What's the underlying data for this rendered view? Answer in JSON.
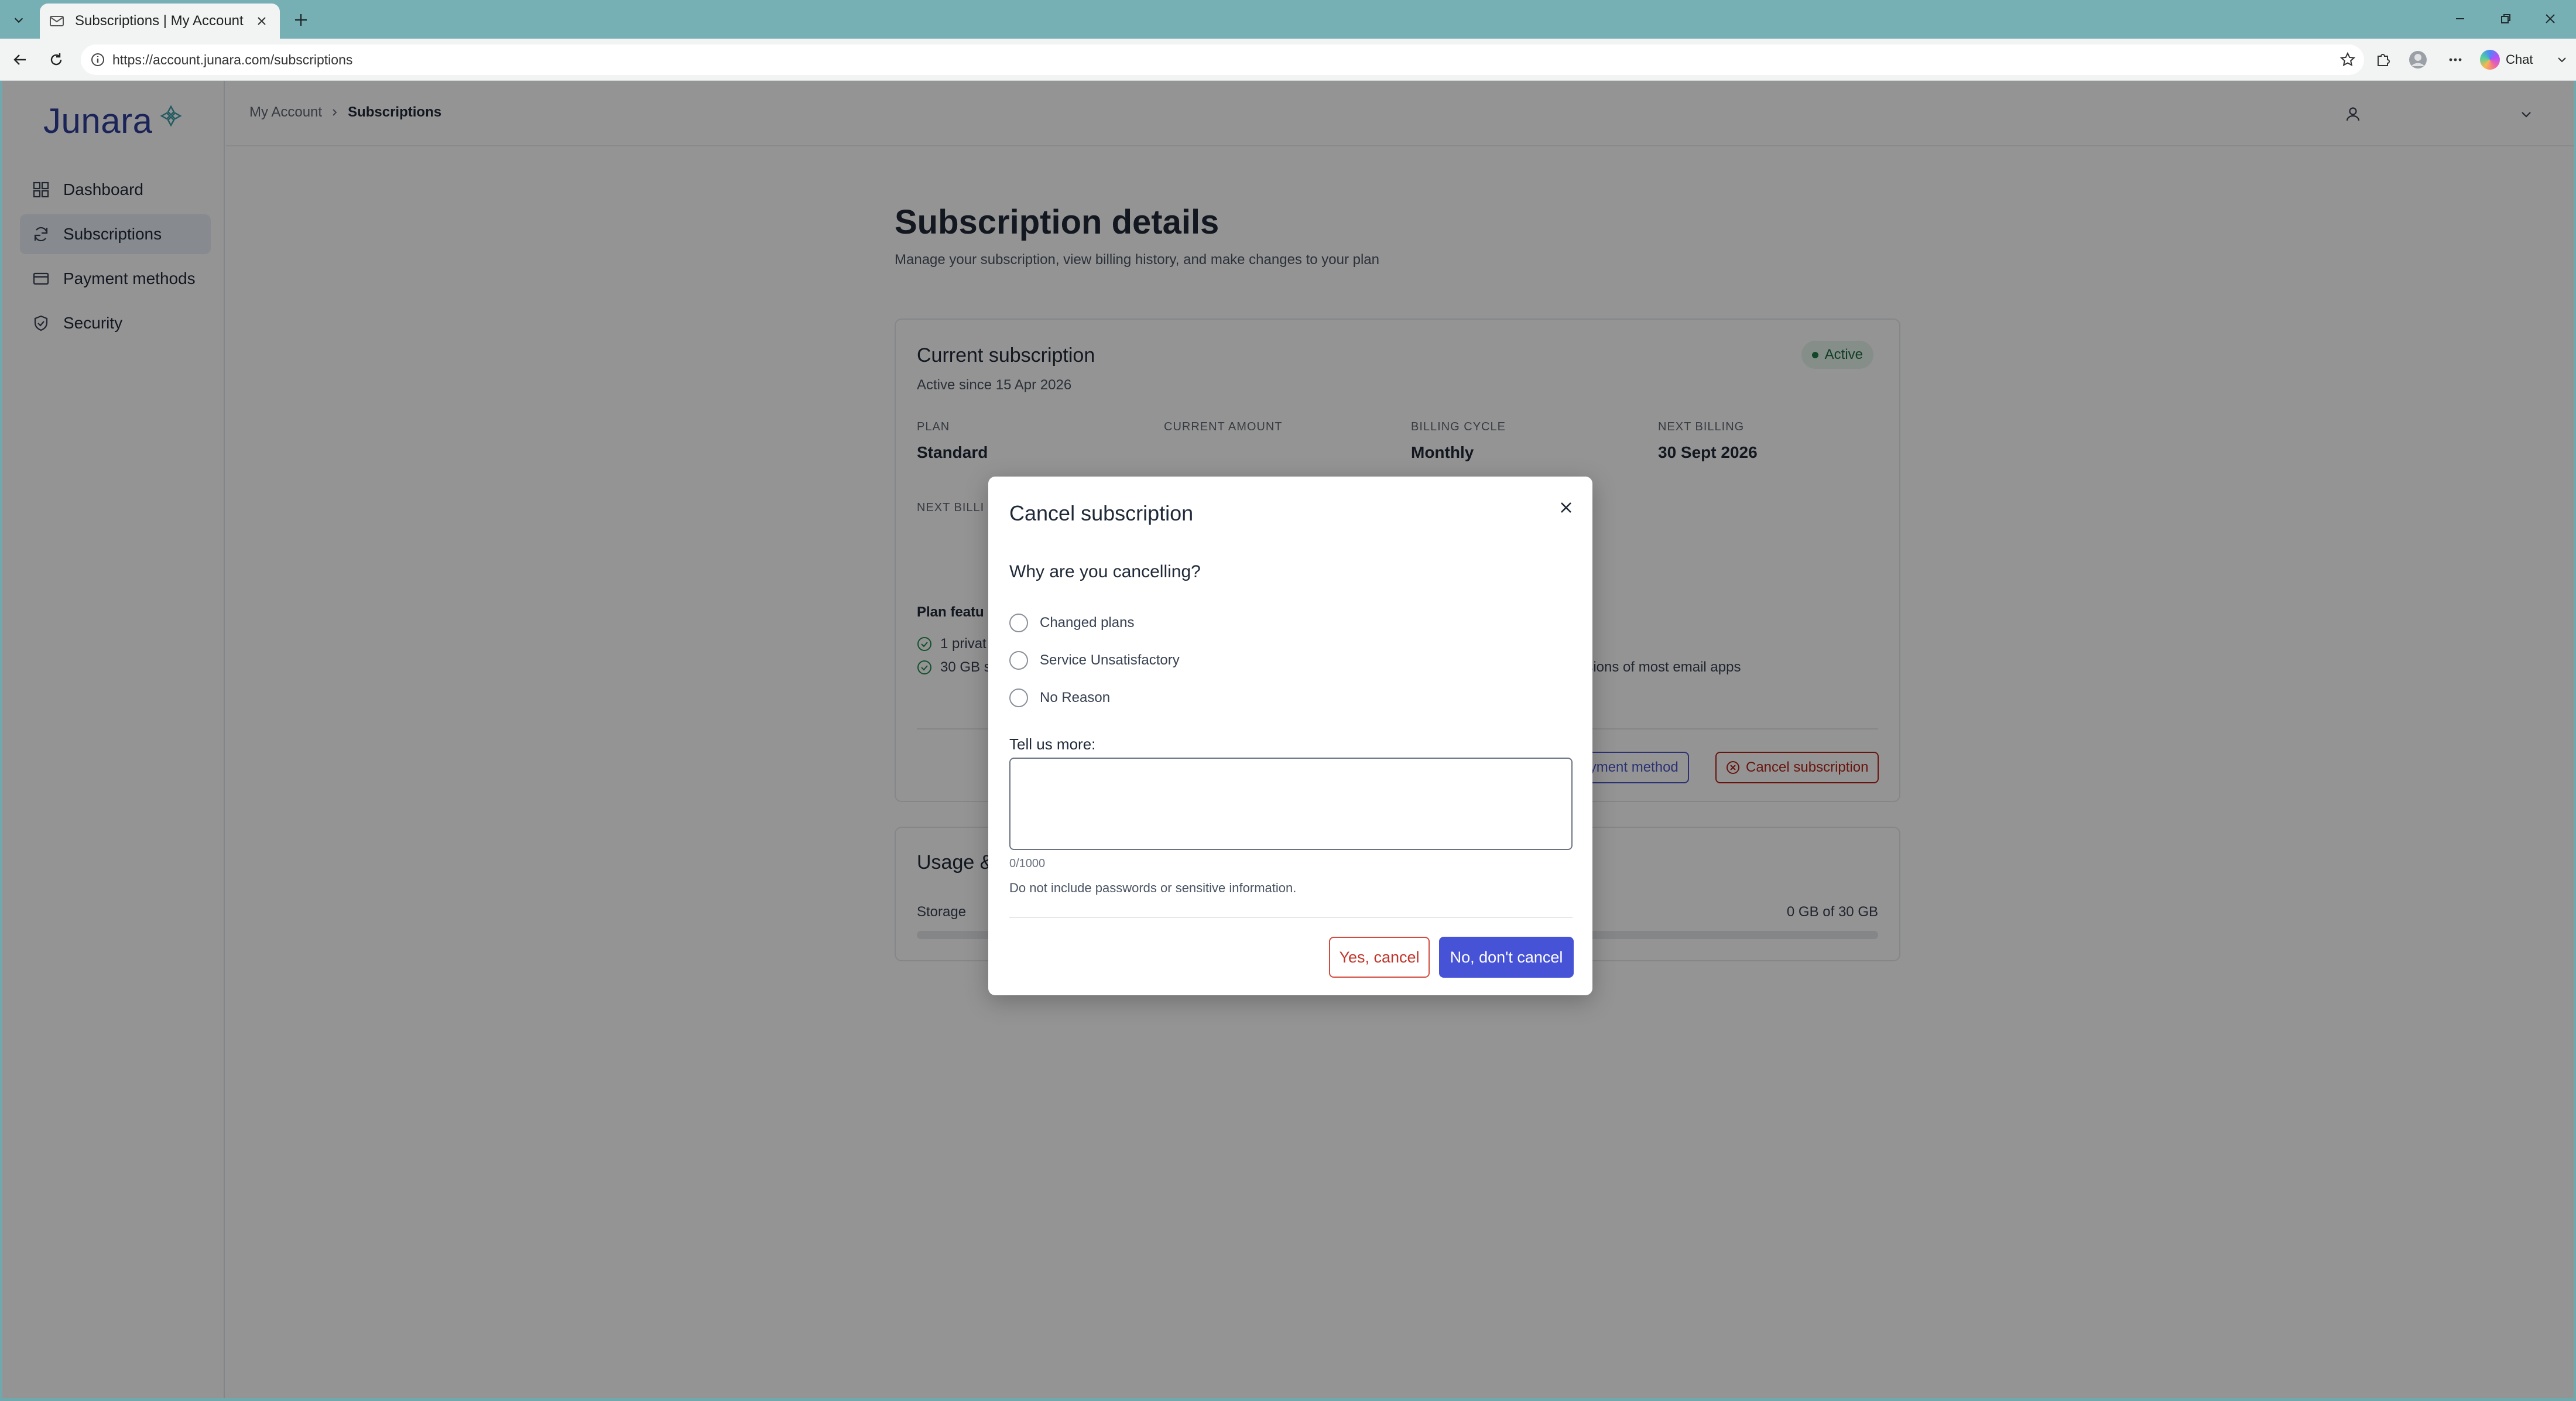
{
  "browser": {
    "tab_title": "Subscriptions | My Account",
    "url": "https://account.junara.com/subscriptions",
    "chat_label": "Chat"
  },
  "sidebar": {
    "brand": "Junara",
    "items": [
      {
        "label": "Dashboard",
        "icon": "grid-icon"
      },
      {
        "label": "Subscriptions",
        "icon": "refresh-icon",
        "active": true
      },
      {
        "label": "Payment methods",
        "icon": "card-icon"
      },
      {
        "label": "Security",
        "icon": "shield-icon"
      }
    ]
  },
  "breadcrumb": {
    "parent": "My Account",
    "current": "Subscriptions"
  },
  "page": {
    "title": "Subscription details",
    "subtitle": "Manage your subscription, view billing history, and make changes to your plan"
  },
  "subscription": {
    "title": "Current subscription",
    "since": "Active since 15 Apr 2026",
    "status": "Active",
    "stats": [
      {
        "label": "PLAN",
        "value": "Standard"
      },
      {
        "label": "CURRENT AMOUNT",
        "value": ""
      },
      {
        "label": "BILLING CYCLE",
        "value": "Monthly"
      },
      {
        "label": "NEXT BILLING",
        "value": "30 Sept 2026"
      }
    ],
    "next_billing_partial": "NEXT BILLI",
    "features_title": "Plan featu",
    "features": [
      "1 privat",
      "30 GB s"
    ],
    "feature_right": "ersions of most email apps",
    "update_payment_label": "payment method",
    "cancel_label": "Cancel subscription"
  },
  "usage": {
    "title": "Usage &",
    "storage_label": "Storage",
    "storage_value": "0 GB of 30 GB",
    "storage_fraction": 0
  },
  "modal": {
    "title": "Cancel subscription",
    "question": "Why are you cancelling?",
    "reasons": [
      "Changed plans",
      "Service Unsatisfactory",
      "No Reason"
    ],
    "more_label": "Tell us more:",
    "textarea_value": "",
    "counter": "0/1000",
    "hint": "Do not include passwords or sensitive information.",
    "yes_label": "Yes, cancel",
    "no_label": "No, don't cancel"
  },
  "colors": {
    "accent": "#4753d6",
    "danger": "#c0352b",
    "brand": "#2f3f99",
    "success": "#1d6b3f"
  }
}
